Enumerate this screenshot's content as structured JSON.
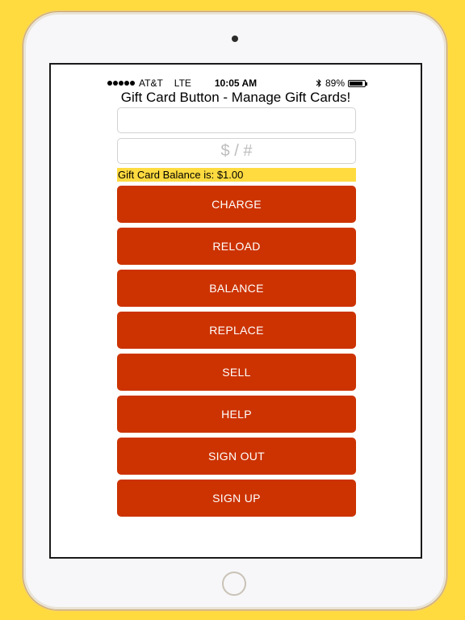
{
  "colors": {
    "background": "#FFDB40",
    "button": "#CC3300",
    "button_text": "#FFFFFF",
    "balance_highlight": "#FFDB40"
  },
  "status_bar": {
    "carrier": "AT&T",
    "network": "LTE",
    "time": "10:05 AM",
    "battery": "89%",
    "battery_level": 0.89,
    "icons": [
      "signal-dots-icon",
      "bluetooth-icon",
      "battery-icon"
    ]
  },
  "app": {
    "title": "Gift Card Button - Manage Gift Cards!"
  },
  "inputs": {
    "card_number": {
      "value": "",
      "placeholder": ""
    },
    "amount": {
      "value": "",
      "placeholder": "$ / #"
    }
  },
  "balance": {
    "text": "Gift Card Balance is: $1.00"
  },
  "buttons": [
    {
      "label": "CHARGE"
    },
    {
      "label": "RELOAD"
    },
    {
      "label": "BALANCE"
    },
    {
      "label": "REPLACE"
    },
    {
      "label": "SELL"
    },
    {
      "label": "HELP"
    },
    {
      "label": "SIGN OUT"
    },
    {
      "label": "SIGN UP"
    }
  ]
}
